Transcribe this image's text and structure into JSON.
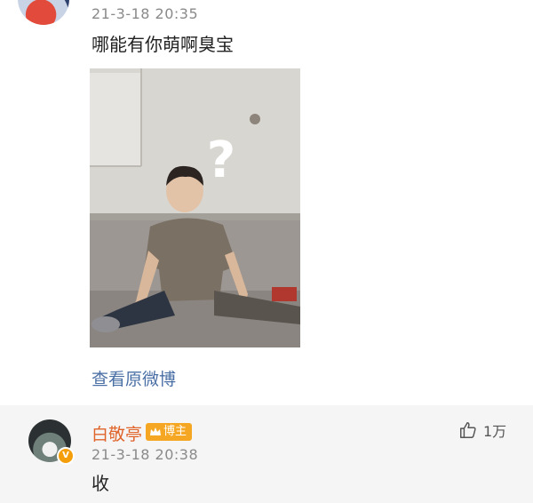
{
  "comment_top": {
    "timestamp": "21-3-18 20:35",
    "text": "哪能有你萌啊臭宝",
    "image_overlay": "?",
    "view_original_label": "查看原微博"
  },
  "comment_bottom": {
    "username": "白敬亭",
    "badge_label": "博主",
    "timestamp": "21-3-18 20:38",
    "text": "收",
    "likes": "1万"
  },
  "colors": {
    "username": "#e0632a",
    "link": "#4a6fa5",
    "badge": "#f5a623",
    "reply_background": "#f5f5f5"
  },
  "icons": [
    "thumb-up-icon",
    "verified-v-icon",
    "crown-icon"
  ]
}
